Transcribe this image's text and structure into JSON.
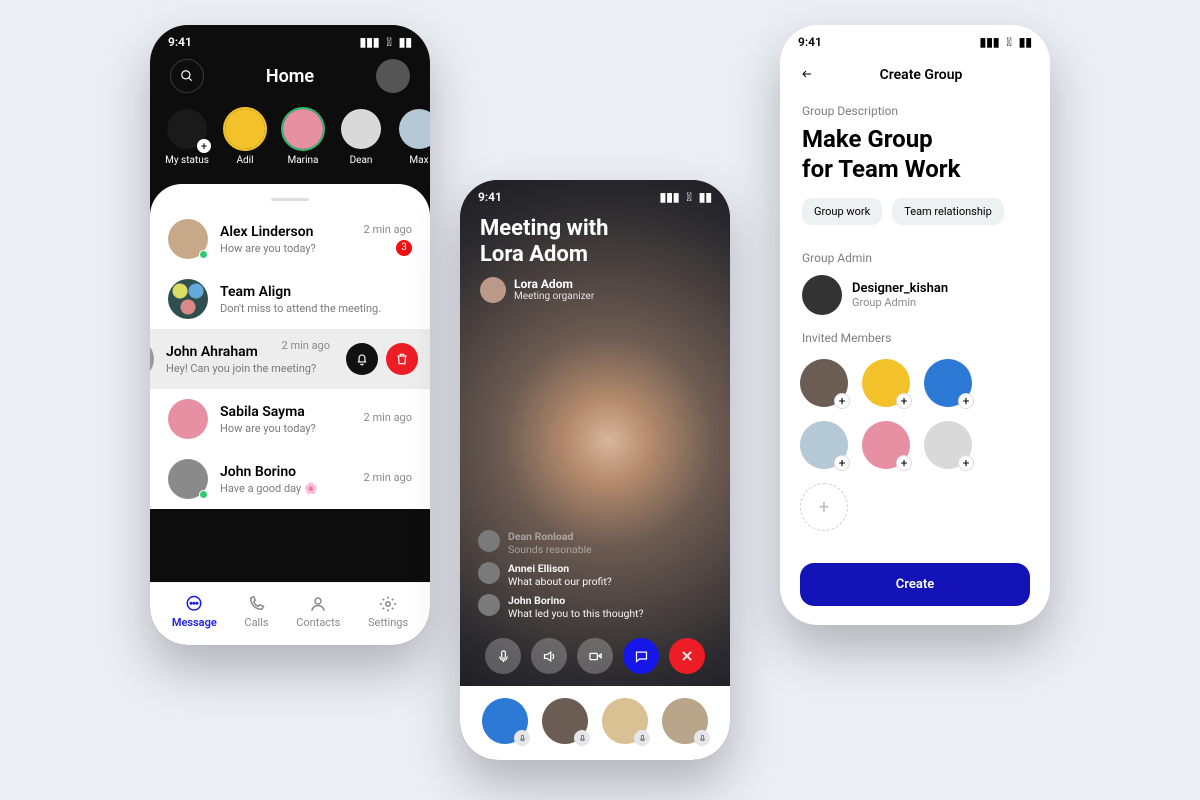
{
  "status_time": "9:41",
  "p1": {
    "title": "Home",
    "stories": [
      {
        "name": "My status",
        "bg": "#1a1a1a",
        "ring": "none",
        "add": true
      },
      {
        "name": "Adil",
        "bg": "#f3c22b",
        "ring": "2px solid #f3c22b"
      },
      {
        "name": "Marina",
        "bg": "#e78fa3",
        "ring": "2px solid #2dbb6e"
      },
      {
        "name": "Dean",
        "bg": "#d9d9d9",
        "ring": "none"
      },
      {
        "name": "Max",
        "bg": "#b5c8d6",
        "ring": "none"
      }
    ],
    "chats": [
      {
        "name": "Alex Linderson",
        "sub": "How are you today?",
        "time": "2 min ago",
        "badge": "3",
        "online": true,
        "av": "#c7a98a"
      },
      {
        "name": "Team Align",
        "sub": "Don't miss to attend the meeting.",
        "time": "",
        "badge": "",
        "online": false,
        "group": true
      },
      {
        "name": "John Ahraham",
        "sub": "Hey! Can you join the meeting?",
        "time": "2 min ago",
        "badge": "",
        "online": false,
        "swiped": true
      },
      {
        "name": "Sabila Sayma",
        "sub": "How are you today?",
        "time": "2 min ago",
        "badge": "",
        "online": false,
        "av": "#e78fa3"
      },
      {
        "name": "John Borino",
        "sub": "Have a good day 🌸",
        "time": "2 min ago",
        "badge": "",
        "online": true,
        "av": "#8a8a8a"
      }
    ],
    "tabs": [
      "Message",
      "Calls",
      "Contacts",
      "Settings"
    ]
  },
  "p2": {
    "title_l1": "Meeting with",
    "title_l2": "Lora Adom",
    "organizer_name": "Lora Adom",
    "organizer_role": "Meeting organizer",
    "chat": [
      {
        "name": "Dean Ronload",
        "msg": "Sounds resonable",
        "faded": true
      },
      {
        "name": "Annei Ellison",
        "msg": "What about our profit?",
        "faded": false
      },
      {
        "name": "John Borino",
        "msg": "What led you to this thought?",
        "faded": false
      }
    ],
    "participants": [
      "#2c7ad6",
      "#6b5d54",
      "#d9c193",
      "#b8a58a"
    ]
  },
  "p3": {
    "header": "Create Group",
    "section_desc": "Group Description",
    "big_title_l1": "Make Group",
    "big_title_l2": "for Team Work",
    "tags": [
      "Group work",
      "Team  relationship"
    ],
    "section_admin": "Group Admin",
    "admin_name": "Designer_kishan",
    "admin_role": "Group Admin",
    "section_members": "Invited Members",
    "members": [
      "#6b5d54",
      "#f3c22b",
      "#2c7ad6",
      "#b5c8d6",
      "#e78fa3",
      "#d9d9d9"
    ],
    "create_label": "Create"
  }
}
